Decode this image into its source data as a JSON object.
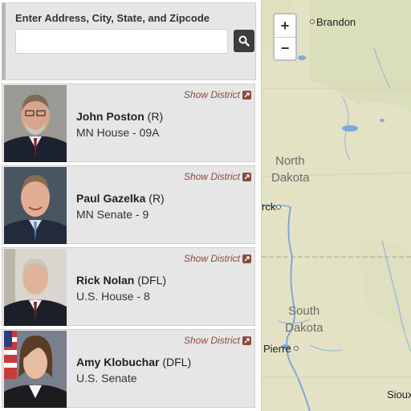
{
  "search": {
    "label": "Enter Address, City, State, and Zipcode",
    "placeholder": "",
    "value": ""
  },
  "representatives": [
    {
      "name": "John Poston",
      "party": "(R)",
      "district": "MN House - 09A",
      "link_label": "Show District",
      "photo_icon": "headshot-photo"
    },
    {
      "name": "Paul Gazelka",
      "party": "(R)",
      "district": "MN Senate - 9",
      "link_label": "Show District",
      "photo_icon": "headshot-photo"
    },
    {
      "name": "Rick Nolan",
      "party": "(DFL)",
      "district": "U.S. House - 8",
      "link_label": "Show District",
      "photo_icon": "headshot-photo"
    },
    {
      "name": "Amy Klobuchar",
      "party": "(DFL)",
      "district": "U.S. Senate",
      "link_label": "Show District",
      "photo_icon": "headshot-photo"
    }
  ],
  "map": {
    "zoom_in": "+",
    "zoom_out": "−",
    "labels": {
      "brandon": "Brandon",
      "north_dakota_1": "North",
      "north_dakota_2": "Dakota",
      "bismarck_partial": "rck",
      "south_dakota_1": "South",
      "south_dakota_2": "Dakota",
      "pierre": "Pierre",
      "sioux_partial": "Sioux"
    }
  },
  "colors": {
    "link": "#8a4b3c",
    "card_bg": "#e6e6e6",
    "map_bg": "#e6e3c6"
  }
}
